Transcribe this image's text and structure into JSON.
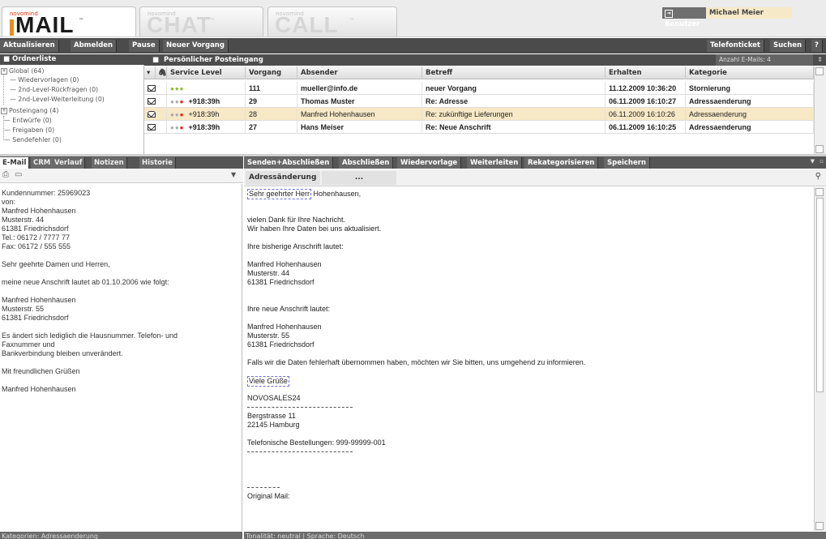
{
  "apps": [
    {
      "small": "novomind",
      "name": "MAIL",
      "tm": "™",
      "active": true
    },
    {
      "small": "novomind",
      "name": "CHAT",
      "tm": "™",
      "active": false
    },
    {
      "small": "novomind",
      "name": "CALL",
      "tm": "™",
      "active": false
    }
  ],
  "header": {
    "user_label": "Benutzer",
    "user_name": "Michael Meier"
  },
  "toolbar": {
    "items": [
      "Aktualisieren",
      "Abmelden",
      "Pause",
      "Neuer Vorgang"
    ],
    "right": [
      "Telefonticket",
      "Suchen",
      "?"
    ]
  },
  "folders": {
    "title": "Ordnerliste",
    "items": [
      "Global (64)",
      "Wiedervorlagen (0)",
      "2nd-Level-Rückfragen (0)",
      "2nd-Level-Weiterleitung (0)",
      "Posteingang (4)",
      "Entwürfe (0)",
      "Freigaben (0)",
      "Sendefehler (0)"
    ]
  },
  "inbox": {
    "title": "Persönlicher Posteingang",
    "count_label": "Anzahl E-Mails: 4",
    "columns": [
      "Service Level",
      "Vorgang",
      "Absender",
      "Betreff",
      "Erhalten",
      "Kategorie"
    ],
    "rows": [
      {
        "sl": "",
        "vorgang": "111",
        "absender": "mueller@info.de",
        "betreff": "neuer Vorgang",
        "erhalten": "11.12.2009 10:36:20",
        "kategorie": "Stornierung"
      },
      {
        "sl": "+918:39h",
        "vorgang": "29",
        "absender": "Thomas Muster",
        "betreff": "Re: Adresse",
        "erhalten": "06.11.2009 16:10:27",
        "kategorie": "Adressaenderung"
      },
      {
        "sl": "+918:39h",
        "vorgang": "28",
        "absender": "Manfred Hohenhausen",
        "betreff": "Re: zukünftige Lieferungen",
        "erhalten": "06.11.2009 16:10:26",
        "kategorie": "Adressaenderung"
      },
      {
        "sl": "+918:39h",
        "vorgang": "27",
        "absender": "Hans Meiser",
        "betreff": "Re: Neue Anschrift",
        "erhalten": "06.11.2009 16:10:25",
        "kategorie": "Adressaenderung"
      }
    ]
  },
  "left": {
    "tabs": [
      "E-Mail",
      "CRM",
      "Verlauf",
      "Notizen",
      "Historie"
    ],
    "lines": [
      "Kundennummer: 25969023",
      "von:",
      "Manfred Hohenhausen",
      "Musterstr. 44",
      "61381 Friedrichsdorf",
      "Tel.: 06172 / 7777 77",
      "Fax: 06172 / 555 555",
      "",
      "Sehr geehrte Damen und Herren,",
      "",
      "meine neue Anschrift lautet ab 01.10.2006 wie folgt:",
      "",
      "Manfred Hohenhausen",
      "Musterstr. 55",
      "61381 Friedrichsdorf",
      "",
      "Es ändert sich lediglich die Hausnummer. Telefon- und",
      "Faxnummer und",
      "Bankverbindung bleiben unverändert.",
      "",
      "Mit freundlichen Grüßen",
      "",
      "Manfred Hohenhausen"
    ],
    "status": "Kategorien: Adressaenderung"
  },
  "right": {
    "toolbar": [
      "Senden+Abschließen",
      "Abschließen",
      "Wiedervorlage",
      "Weiterleiten",
      "Rekategorisieren",
      "Speichern"
    ],
    "subject": "Adressänderung",
    "subject_more": "...",
    "greeting_hl": "Sehr geehrter Herr",
    "greeting_rest": " Hohenhausen,",
    "lines_a": [
      "vielen Dank für Ihre Nachricht.",
      "Wir haben Ihre Daten bei uns aktualisiert."
    ],
    "old_label": "Ihre bisherige Anschrift lautet:",
    "old_addr": [
      "Manfred Hohenhausen",
      "Musterstr. 44",
      "61381 Friedrichsdorf"
    ],
    "new_label": "Ihre neue Anschrift lautet:",
    "new_addr": [
      "Manfred Hohenhausen",
      "Musterstr. 55",
      "61381 Friedrichsdorf"
    ],
    "notice": "Falls wir die Daten fehlerhaft übernommen haben, möchten wir Sie bitten, uns umgehend zu informieren.",
    "closing": "Viele Grüße",
    "company": "NOVOSALES24",
    "addr2": [
      "Bergstrasse 11",
      "22145 Hamburg"
    ],
    "phone": "Telefonische Bestellungen: 999-99999-001",
    "original": "Original Mail:",
    "status": "Tonalität: neutral | Sprache: Deutsch"
  }
}
